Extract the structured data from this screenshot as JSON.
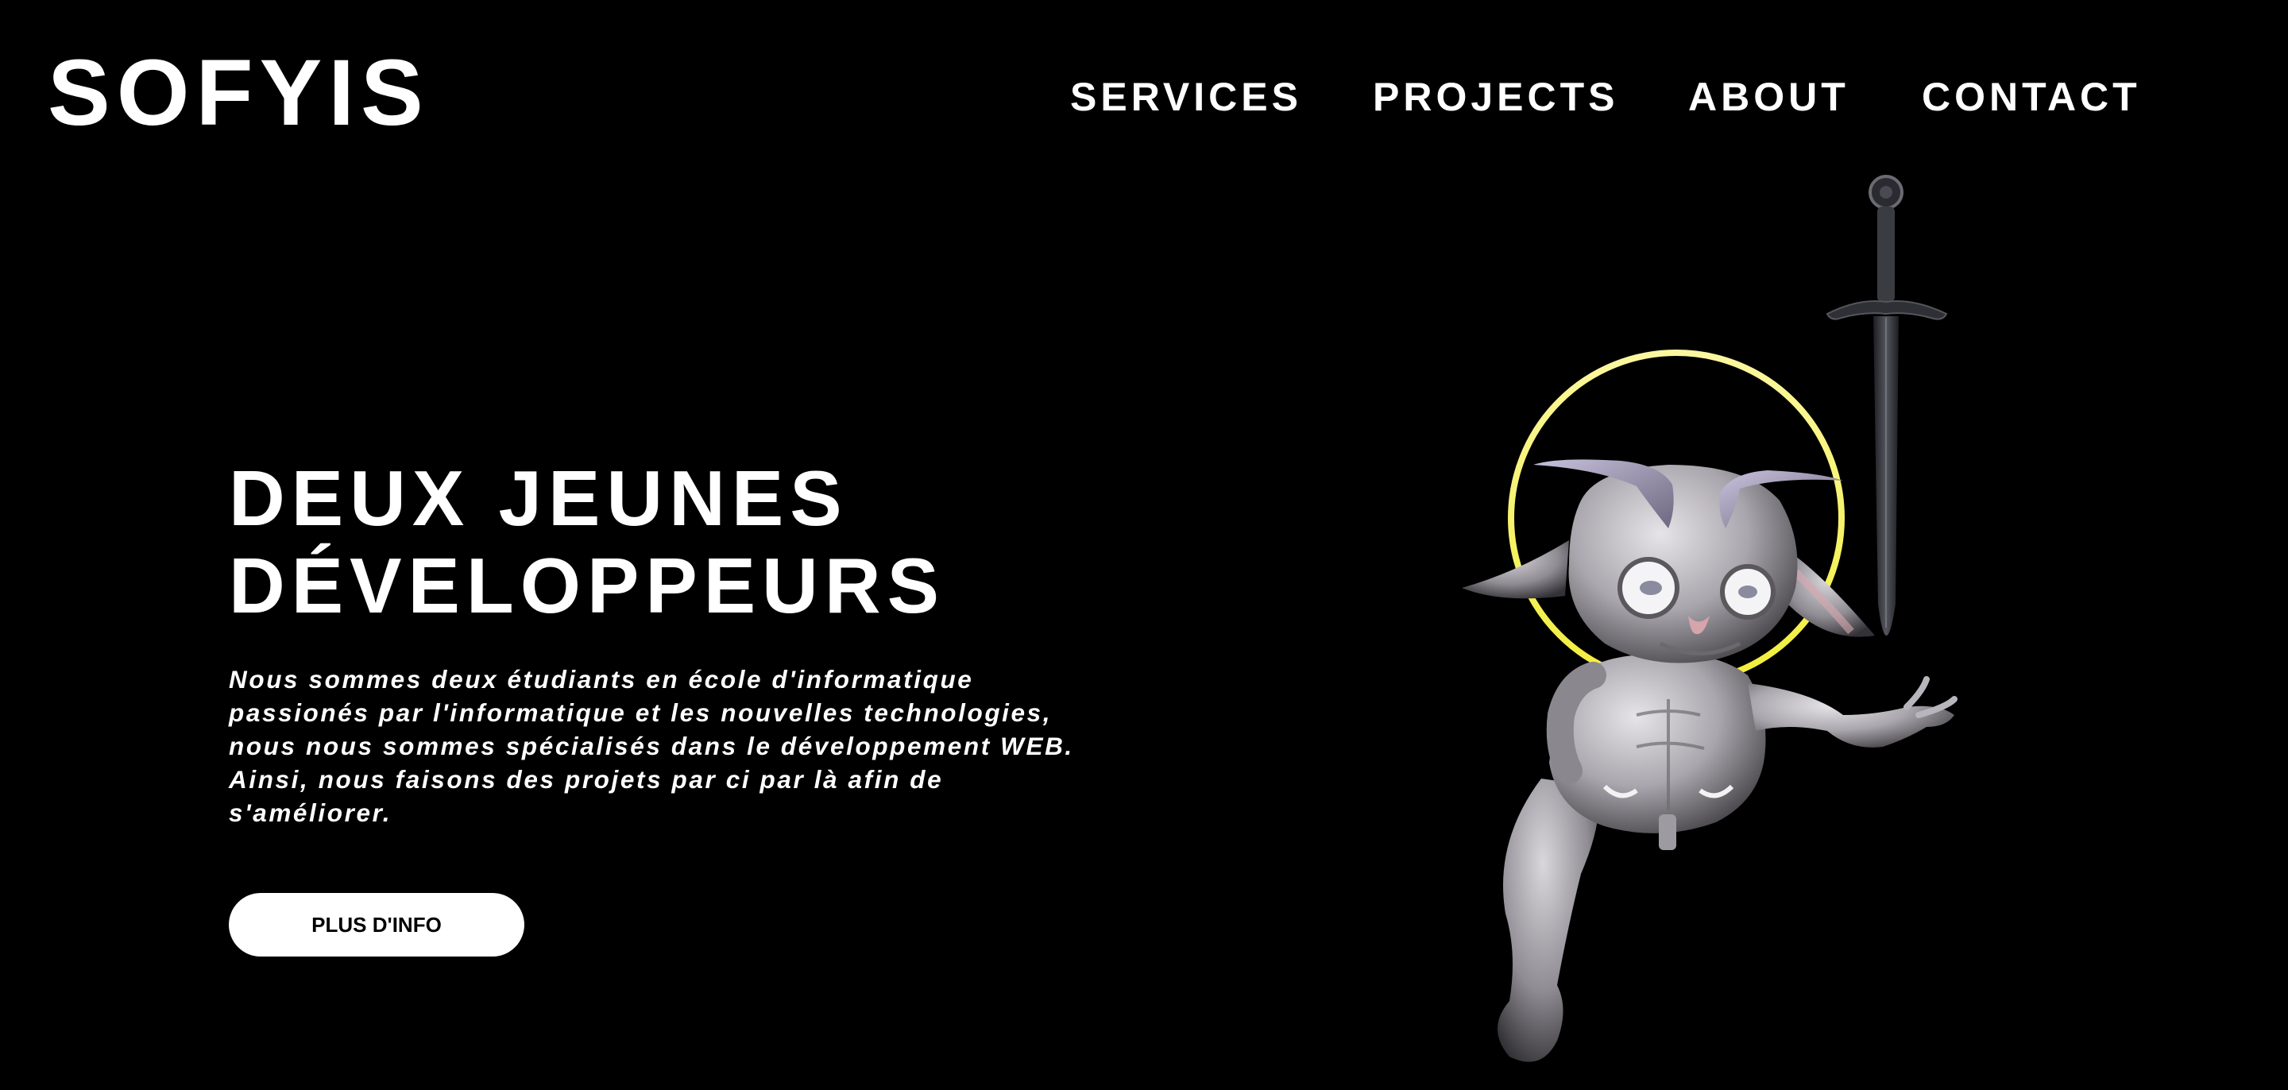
{
  "header": {
    "logo": "SOFYIS",
    "nav": [
      {
        "label": "SERVICES"
      },
      {
        "label": "PROJECTS"
      },
      {
        "label": "ABOUT"
      },
      {
        "label": "CONTACT"
      }
    ]
  },
  "hero": {
    "title_lines": [
      "DEUX JEUNES",
      "DÉVELOPPEURS"
    ],
    "description_lines": [
      "Nous sommes deux étudiants en école d'informatique",
      "passionés par l'informatique et les nouvelles technologies,",
      "nous nous sommes spécialisés dans le développement WEB.",
      "Ainsi, nous faisons des projets par ci par là afin de",
      "s'améliorer."
    ],
    "cta_label": "PLUS D'INFO"
  },
  "colors": {
    "background": "#000000",
    "text": "#ffffff",
    "button_bg": "#ffffff",
    "button_text": "#000000",
    "halo": "#f5f35a"
  },
  "illustration": {
    "icon": "winged-goblin-with-halo-and-sword"
  }
}
